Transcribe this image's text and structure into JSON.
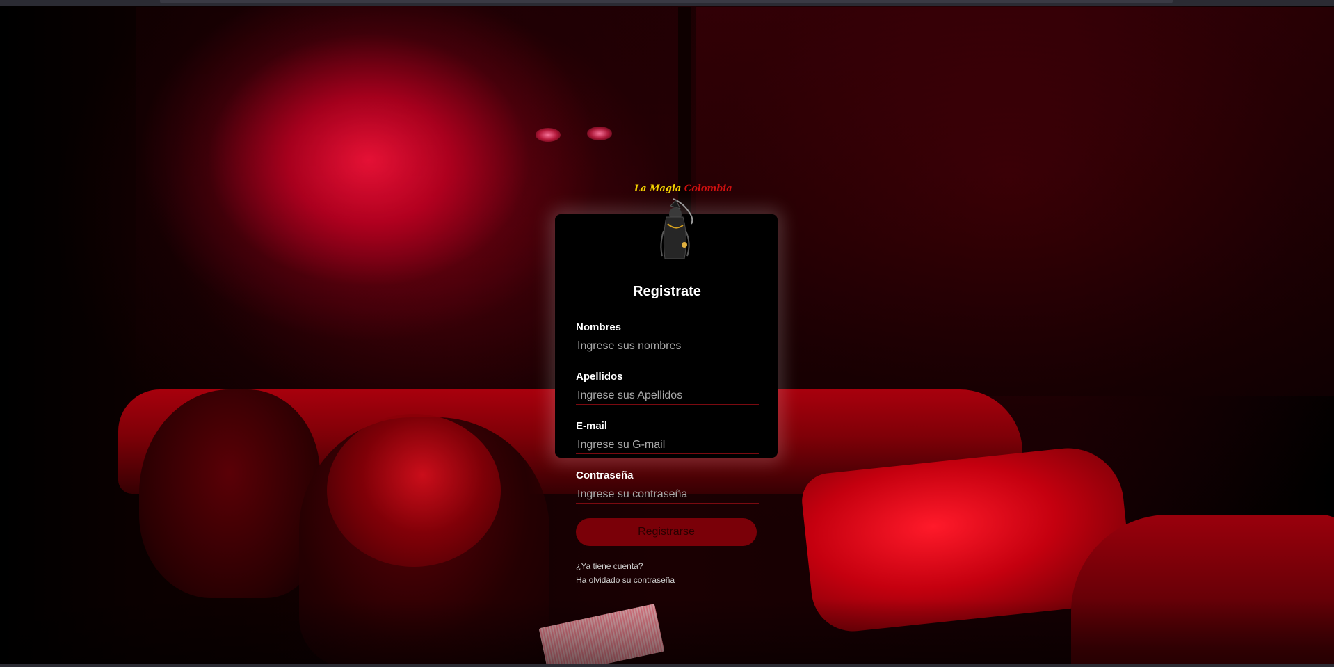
{
  "brand": {
    "logo_word1": "La Magia",
    "logo_word2": "Colombia"
  },
  "form": {
    "title": "Registrate",
    "fields": [
      {
        "label": "Nombres",
        "placeholder": "Ingrese sus nombres"
      },
      {
        "label": "Apellidos",
        "placeholder": "Ingrese sus Apellidos"
      },
      {
        "label": "E-mail",
        "placeholder": "Ingrese su G-mail"
      },
      {
        "label": "Contraseña",
        "placeholder": "Ingrese su contraseña"
      }
    ],
    "submit_label": "Registrarse",
    "links": {
      "have_account": "¿Ya tiene cuenta?",
      "forgot_password": "Ha olvidado su contraseña"
    }
  },
  "colors": {
    "accent": "#7a0008",
    "underline": "#7a0a10",
    "background_red": "#b8000e"
  }
}
